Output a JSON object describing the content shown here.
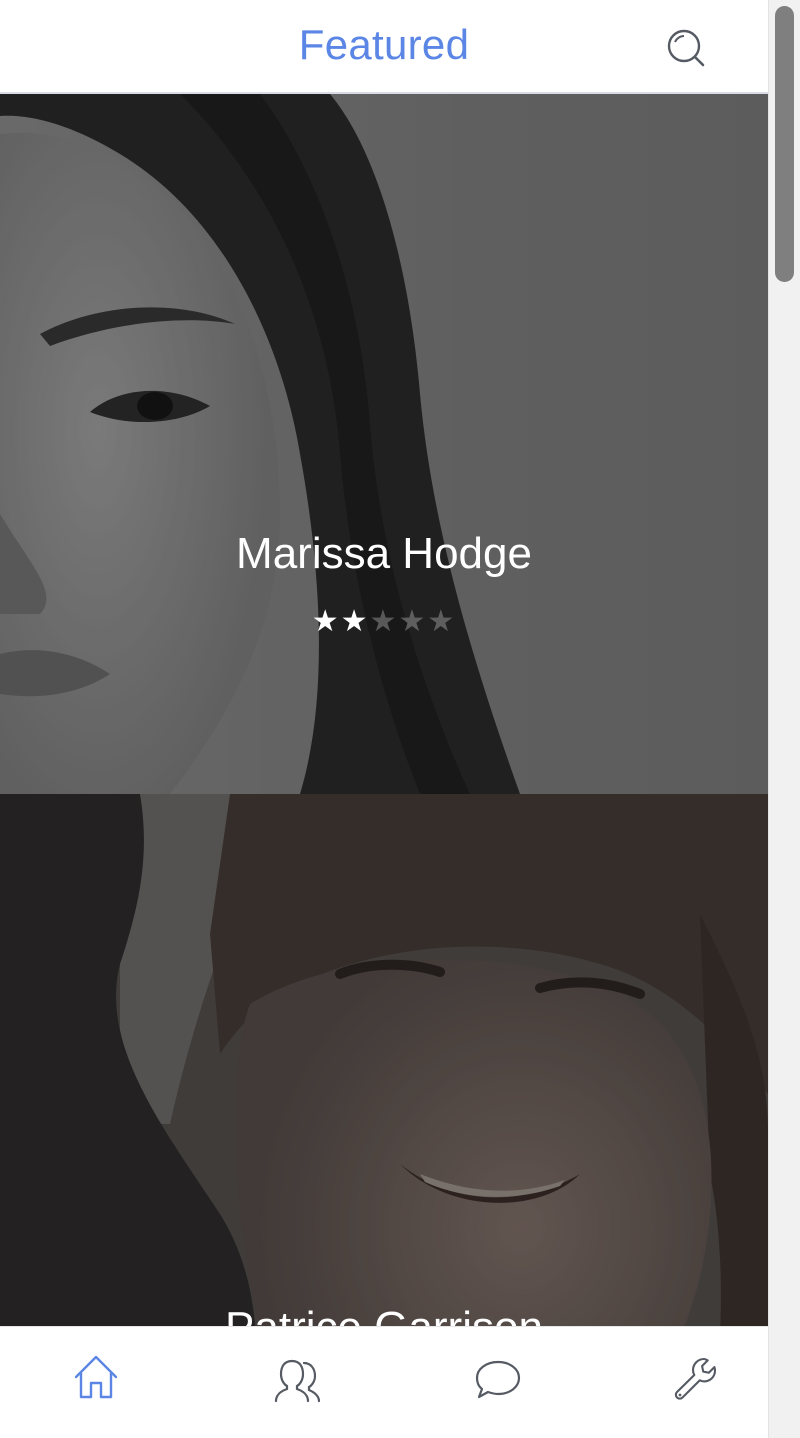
{
  "header": {
    "title": "Featured",
    "search_icon": "search-icon"
  },
  "colors": {
    "accent": "#5b86e5",
    "icon_default": "#555a63",
    "overlay": "rgba(0,0,0,0.35)"
  },
  "profiles": [
    {
      "name": "Marissa Hodge",
      "rating": 2,
      "rating_max": 5
    },
    {
      "name": "Patrice Garrison"
    }
  ],
  "tabbar": {
    "items": [
      {
        "icon": "home-icon",
        "active": true
      },
      {
        "icon": "people-icon",
        "active": false
      },
      {
        "icon": "chat-bubble-icon",
        "active": false
      },
      {
        "icon": "wrench-icon",
        "active": false
      }
    ]
  },
  "scrollbar": {
    "scroll_position": 0
  }
}
